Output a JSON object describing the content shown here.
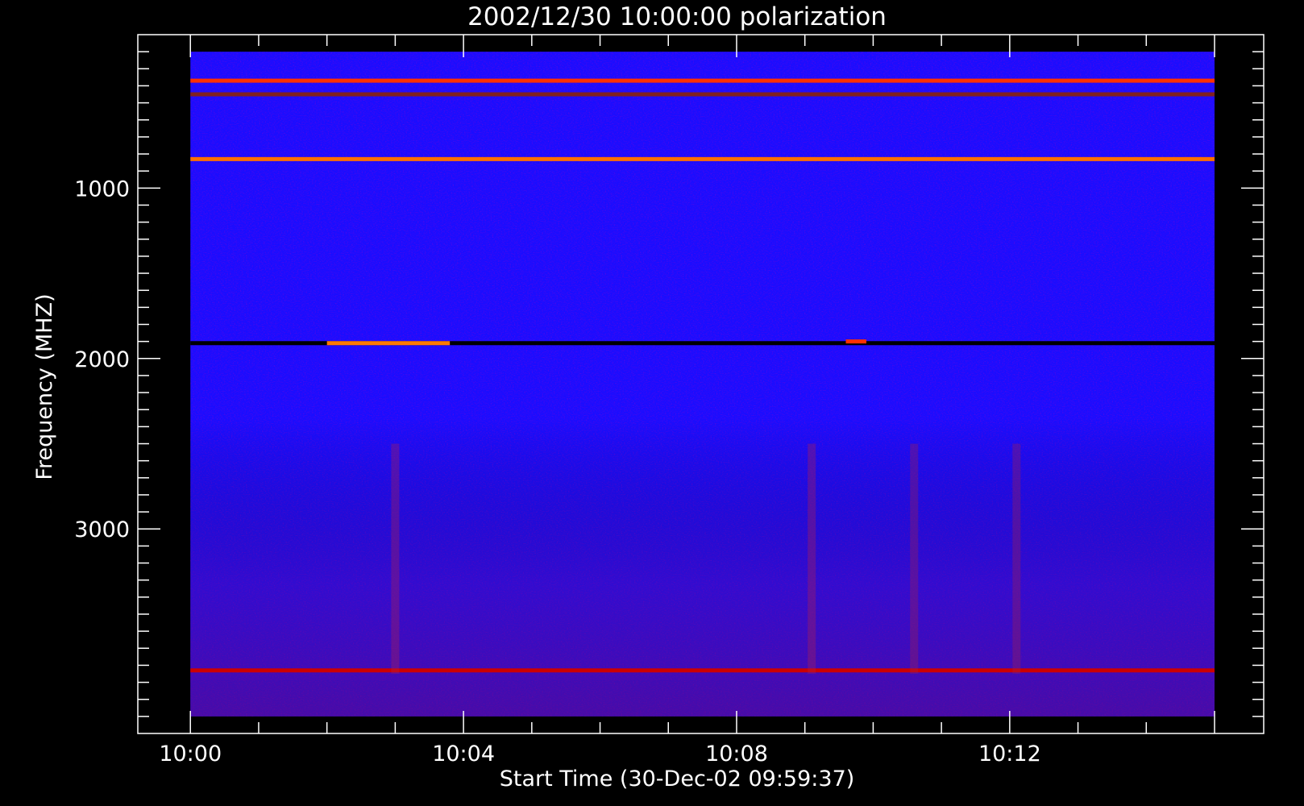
{
  "chart_data": {
    "type": "heatmap",
    "title": "2002/12/30 10:00:00 polarization",
    "xlabel": "Start Time (30-Dec-02 09:59:37)",
    "ylabel": "Frequency (MHZ)",
    "x_ticks": [
      "10:00",
      "10:04",
      "10:08",
      "10:12"
    ],
    "x_tick_minutes": [
      0,
      4,
      8,
      12
    ],
    "x_minor_step_minutes": 1,
    "x_range_minutes": [
      -0.77,
      15.72
    ],
    "data_x_range_minutes": [
      0,
      15
    ],
    "y_ticks": [
      1000,
      2000,
      3000
    ],
    "y_minor_step": 100,
    "y_range": [
      100,
      4200
    ],
    "data_y_range": [
      200,
      4100
    ],
    "y_inverted": true,
    "colormap": [
      "#000000",
      "#0000ff",
      "#c00000",
      "#ff4000",
      "#ffd000",
      "#ffffff"
    ],
    "background_color": "#1a0dff",
    "frame_color": "#ffffff",
    "features": [
      {
        "kind": "horizontal_band",
        "freq": 1910,
        "t_start": 0,
        "t_end": 15,
        "color": "#000000"
      },
      {
        "kind": "horizontal_band",
        "freq": 1910,
        "t_start": 2.0,
        "t_end": 3.8,
        "color": "#ff7a00"
      },
      {
        "kind": "horizontal_band",
        "freq": 1900,
        "t_start": 9.6,
        "t_end": 9.9,
        "color": "#ff3000"
      },
      {
        "kind": "horizontal_band",
        "freq": 3830,
        "t_start": 0,
        "t_end": 15,
        "color": "#cc0000"
      },
      {
        "kind": "horizontal_band",
        "freq": 830,
        "t_start": 0,
        "t_end": 15,
        "color": "#ff7000"
      },
      {
        "kind": "horizontal_band",
        "freq": 370,
        "t_start": 0,
        "t_end": 15,
        "color": "#ff3000"
      },
      {
        "kind": "horizontal_band",
        "freq": 450,
        "t_start": 0,
        "t_end": 15,
        "color": "#802020"
      },
      {
        "kind": "vertical_streak",
        "t": 3.0,
        "color": "#b02050"
      },
      {
        "kind": "vertical_streak",
        "t": 9.1,
        "color": "#b02050"
      },
      {
        "kind": "vertical_streak",
        "t": 10.6,
        "color": "#a02050"
      },
      {
        "kind": "vertical_streak",
        "t": 12.1,
        "color": "#a02050"
      }
    ]
  }
}
